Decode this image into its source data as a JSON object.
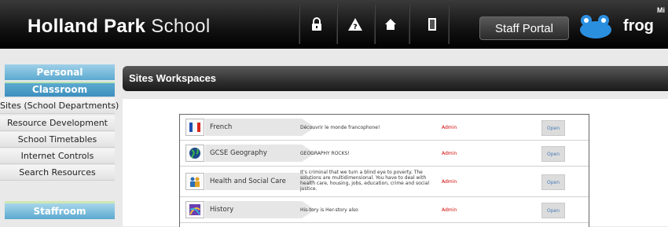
{
  "header": {
    "logo_bold": "Holland Park",
    "logo_light": "School",
    "staff_portal_label": "Staff Portal",
    "frog_label": "frog",
    "cut_text": "Mi",
    "icons": [
      "lock-icon",
      "warning-icon",
      "home-icon",
      "door-icon"
    ]
  },
  "sidebar": {
    "personal": "Personal",
    "classroom": "Classroom",
    "items": [
      {
        "label": "Sites (School Departments)"
      },
      {
        "label": "Resource Development"
      },
      {
        "label": "School Timetables"
      },
      {
        "label": "Internet Controls"
      },
      {
        "label": "Search Resources"
      }
    ],
    "staffroom": "Staffroom"
  },
  "main": {
    "title": "Sites Workspaces",
    "sites": [
      {
        "name": "French",
        "description": "Découvrir le monde francophone!",
        "role": "Admin",
        "action": "Open",
        "icon": "french-flag-icon"
      },
      {
        "name": "GCSE Geography",
        "description": "GEOGRAPHY ROCKS!",
        "role": "Admin",
        "action": "Open",
        "icon": "globe-icon"
      },
      {
        "name": "Health and Social Care",
        "description": "It's criminal that we turn a blind eye to poverty. The solutions are multidimensional. You have to deal with health care, housing, jobs, education, crime and social justice.",
        "role": "Admin",
        "action": "Open",
        "icon": "people-icon"
      },
      {
        "name": "History",
        "description": "His-tory is Her-story also",
        "role": "Admin",
        "action": "Open",
        "icon": "history-icon"
      }
    ]
  },
  "colors": {
    "accent_blue": "#5ba9d0",
    "admin_red": "#d00000",
    "open_link": "#4a7bb7"
  }
}
